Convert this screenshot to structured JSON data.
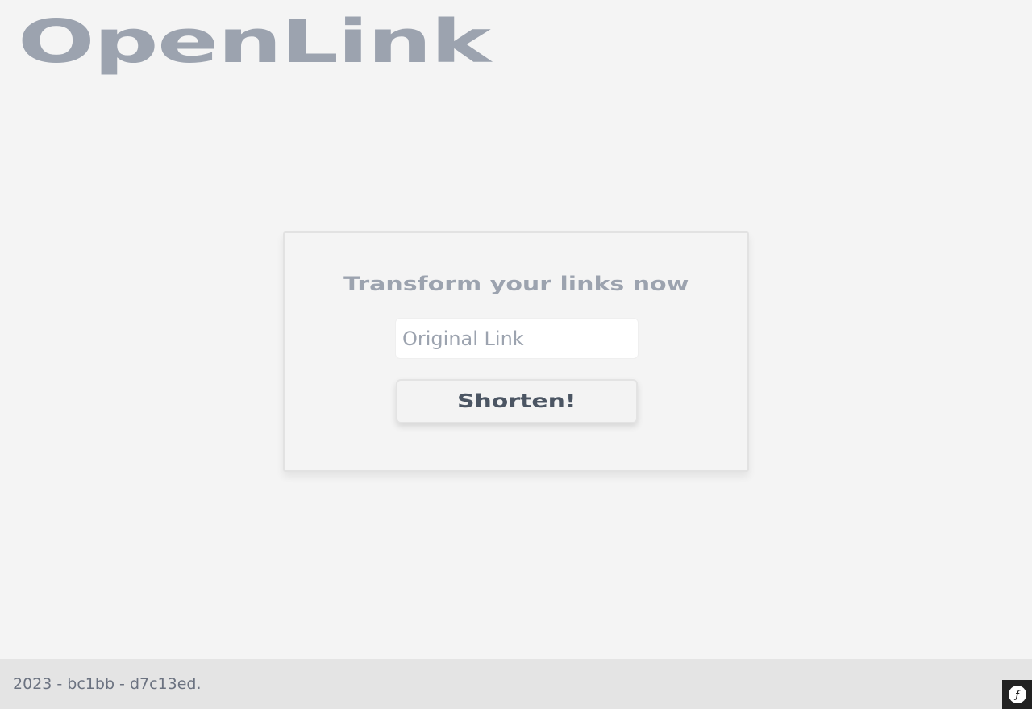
{
  "app": {
    "logo_text": "OpenLink"
  },
  "form": {
    "title": "Transform your links now",
    "input_placeholder": "Original Link",
    "input_value": "",
    "submit_label": "Shorten!"
  },
  "footer": {
    "text": "2023 - bc1bb - d7c13ed."
  },
  "debug_toolbar": {
    "icon": "symfony-icon"
  },
  "colors": {
    "background": "#f4f4f4",
    "logo": "#9ca3af",
    "button_text": "#4b5563",
    "footer_background": "#e4e4e4",
    "toolbar_background": "#222222"
  }
}
